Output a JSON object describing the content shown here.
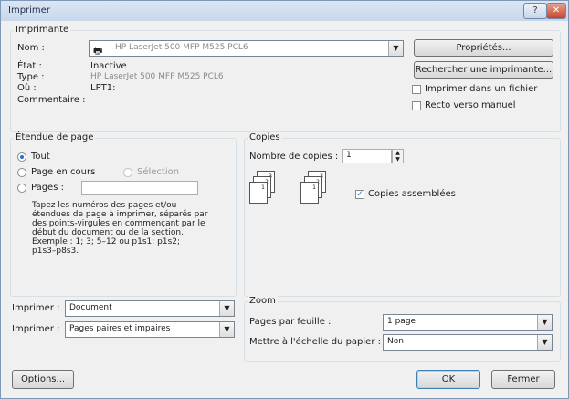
{
  "window": {
    "title": "Imprimer",
    "help": "?",
    "close": "✕"
  },
  "printer": {
    "group": "Imprimante",
    "name_label": "Nom :",
    "name_value": "HP LaserJet 500 MFP M525 PCL6",
    "state_label": "État :",
    "state_value": "Inactive",
    "type_label": "Type :",
    "type_value": "HP LaserJet 500 MFP M525 PCL6",
    "where_label": "Où :",
    "where_value": "LPT1:",
    "comment_label": "Commentaire :",
    "properties_btn": "Propriétés...",
    "find_btn": "Rechercher une imprimante...",
    "print_to_file": "Imprimer dans un fichier",
    "manual_duplex": "Recto verso manuel"
  },
  "range": {
    "group": "Étendue de page",
    "all": "Tout",
    "current": "Page en cours",
    "selection": "Sélection",
    "pages": "Pages :",
    "hint": "Tapez les numéros des pages et/ou\nétendues de page à imprimer, séparés par\ndes points-virgules en commençant par le\ndébut du document ou de la section.\nExemple : 1; 3; 5–12 ou p1s1; p1s2;\np1s3–p8s3."
  },
  "copies": {
    "group": "Copies",
    "count_label": "Nombre de copies :",
    "count_value": "1",
    "collate": "Copies assemblées",
    "doc_pages": [
      "1",
      "2",
      "3"
    ]
  },
  "print_what": {
    "label": "Imprimer :",
    "value": "Document"
  },
  "print_pages": {
    "label": "Imprimer :",
    "value": "Pages paires et impaires"
  },
  "zoom": {
    "group": "Zoom",
    "per_sheet_label": "Pages par feuille :",
    "per_sheet_value": "1 page",
    "scale_label": "Mettre à l'échelle du papier :",
    "scale_value": "Non"
  },
  "buttons": {
    "options": "Options...",
    "ok": "OK",
    "close": "Fermer"
  }
}
